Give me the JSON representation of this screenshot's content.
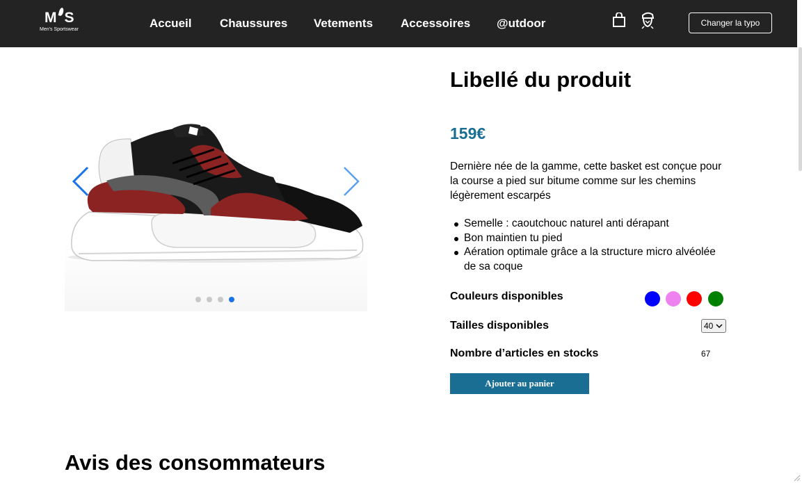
{
  "header": {
    "logo": {
      "mark": "M'S",
      "subtitle": "Men's Sportswear"
    },
    "nav": [
      {
        "label": "Accueil"
      },
      {
        "label": "Chaussures"
      },
      {
        "label": "Vetements"
      },
      {
        "label": "Accessoires"
      },
      {
        "label": "@utdoor"
      }
    ],
    "icons": [
      "shopping-bag-icon",
      "user-icon"
    ],
    "typo_button": "Changer la typo"
  },
  "carousel": {
    "slide_count": 4,
    "active_slide": 4
  },
  "product": {
    "title": "Libellé du produit",
    "price": "159€",
    "description": "Dernière née de la gamme, cette basket est conçue pour la course a pied sur bitume comme sur les chemins légèrement escarpés",
    "features": [
      "Semelle : caoutchouc naturel anti dérapant",
      "Bon maintien tu pied",
      "Aération optimale grâce a la structure micro alvéolée de sa coque"
    ],
    "colors_label": "Couleurs disponibles",
    "colors": [
      "#0000ff",
      "#ee82ee",
      "#ff0000",
      "#008000"
    ],
    "sizes_label": "Tailles disponibles",
    "size_selected": "40",
    "stock_label": "Nombre d’articles en stocks",
    "stock_value": "67",
    "add_button": "Ajouter au panier",
    "price_color": "#1a6e93"
  },
  "reviews": {
    "title": "Avis des consommateurs"
  }
}
